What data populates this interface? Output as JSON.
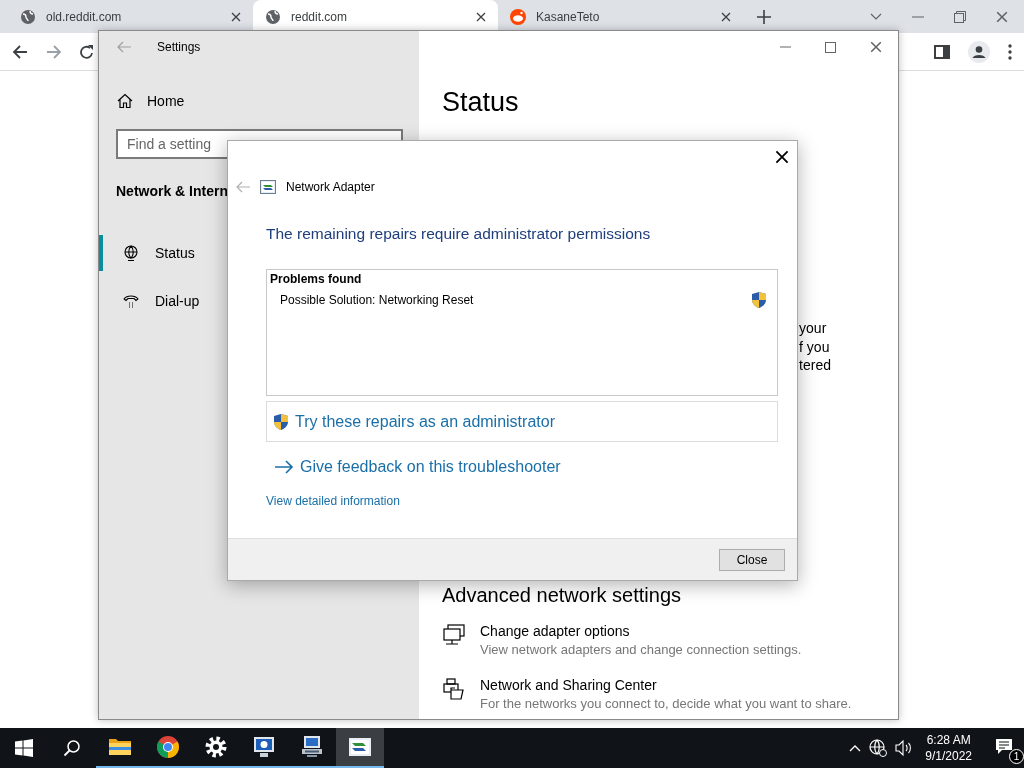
{
  "browser": {
    "tabs": [
      {
        "title": "old.reddit.com",
        "kind": "globe",
        "selected": false
      },
      {
        "title": "reddit.com",
        "kind": "globe",
        "selected": true
      },
      {
        "title": "KasaneTeto",
        "kind": "favicon",
        "selected": false
      }
    ]
  },
  "settings_window": {
    "title": "Settings",
    "sidebar": {
      "home": "Home",
      "search": {
        "placeholder": "Find a setting"
      },
      "section_title": "Network & Intern",
      "items": [
        {
          "label": "Status",
          "kind": "status",
          "selected": true
        },
        {
          "label": "Dial-up",
          "kind": "dialup",
          "selected": false
        }
      ]
    },
    "content": {
      "heading": "Status",
      "text_fragments": [
        "your",
        "f you",
        "tered"
      ],
      "section_heading": "Advanced network settings",
      "links": [
        {
          "kind": "adapter",
          "title": "Change adapter options",
          "description": "View network adapters and change connection settings."
        },
        {
          "kind": "sharing",
          "title": "Network and Sharing Center",
          "description": "For the networks you connect to, decide what you want to share."
        }
      ]
    }
  },
  "dialog": {
    "title": "Network Adapter",
    "heading": "The remaining repairs require administrator permissions",
    "problems": {
      "title": "Problems found",
      "items": [
        "Possible Solution: Networking Reset"
      ]
    },
    "admin_action": "Try these repairs as an administrator",
    "feedback_link": "Give feedback on this troubleshooter",
    "details_link": "View detailed information",
    "buttons": [
      "Close"
    ]
  },
  "taskbar": {
    "apps": [
      {
        "kind": "explorer",
        "selected": false
      },
      {
        "kind": "chrome",
        "selected": false
      },
      {
        "kind": "settings",
        "selected": false
      },
      {
        "kind": "monitor",
        "selected": false
      },
      {
        "kind": "network",
        "selected": false
      },
      {
        "kind": "adapter",
        "selected": true
      }
    ],
    "clock": {
      "time": "6:28 AM",
      "date": "9/1/2022"
    },
    "notifications": {
      "count": "1"
    }
  }
}
